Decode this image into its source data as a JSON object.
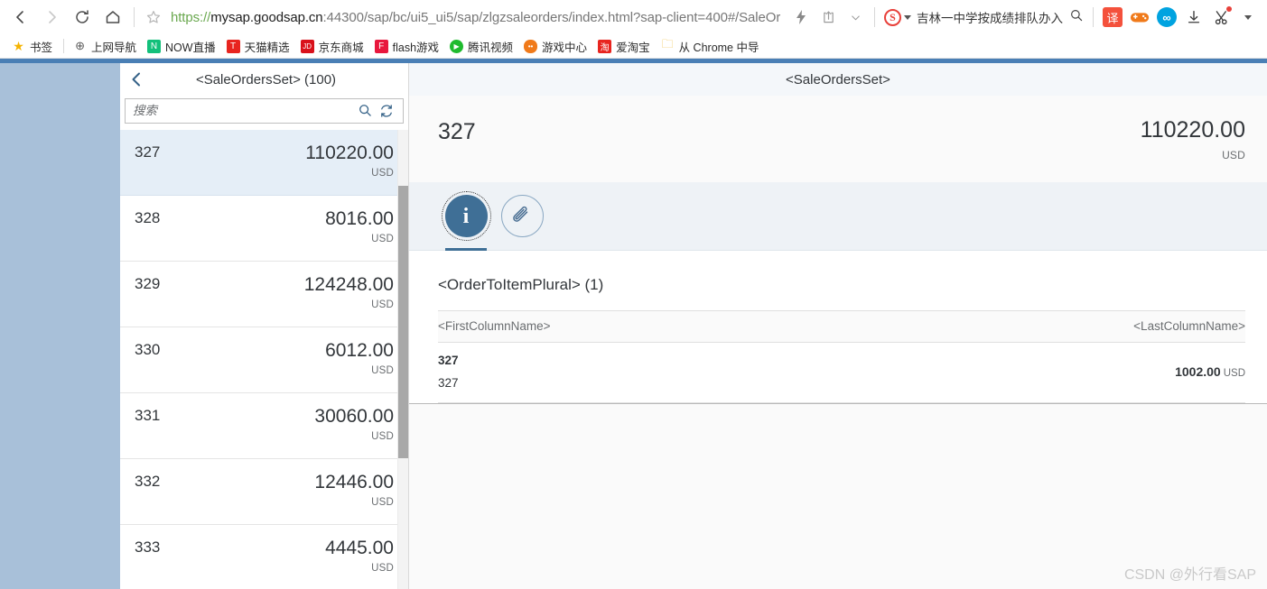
{
  "browser": {
    "nav": {
      "back_label": "Back",
      "forward_label": "Forward",
      "reload_label": "Reload",
      "home_label": "Home",
      "bookmark_star_label": "Bookmark this page"
    },
    "url": {
      "scheme": "https://",
      "host": "mysap.goodsap.cn",
      "rest": ":44300/sap/bc/ui5_ui5/sap/zlgzsaleorders/index.html?sap-client=400#/SaleOr"
    },
    "right_tools": {
      "lightning_label": "Turbo",
      "share_label": "Share",
      "chevron_label": "More",
      "search_engine": "S",
      "search_query": "吉林一中学按成绩排队办入",
      "search_icon_label": "Search",
      "translate_label": "译",
      "game_label": "Game Center",
      "infinity_label": "∞",
      "download_label": "Downloads",
      "capture_label": "Screenshot"
    },
    "bookmarks": [
      {
        "label": "书签",
        "icon": "star-icon",
        "color": "#f5b300",
        "glyph": "★"
      },
      {
        "label": "上网导航",
        "icon": "globe-icon",
        "color": "#ffffff",
        "glyph": "🌐"
      },
      {
        "label": "NOW直播",
        "icon": "now-icon",
        "color": "#13c07b",
        "glyph": "N"
      },
      {
        "label": "天猫精选",
        "icon": "tmall-icon",
        "color": "#e8251f",
        "glyph": "T"
      },
      {
        "label": "京东商城",
        "icon": "jd-icon",
        "color": "#d9111b",
        "glyph": "JD"
      },
      {
        "label": "flash游戏",
        "icon": "flash-icon",
        "color": "#e8173d",
        "glyph": "F"
      },
      {
        "label": "腾讯视频",
        "icon": "tencent-video-icon",
        "color": "#1fbb2e",
        "glyph": "▶"
      },
      {
        "label": "游戏中心",
        "icon": "gamepad-icon",
        "color": "#f07a1a",
        "glyph": "🎮"
      },
      {
        "label": "爱淘宝",
        "icon": "taobao-icon",
        "color": "#e8251f",
        "glyph": "淘"
      },
      {
        "label": "从 Chrome 中导",
        "icon": "folder-icon",
        "color": "#f0c24b",
        "glyph": "📁"
      }
    ]
  },
  "app": {
    "master": {
      "back_label": "‹",
      "title": "<SaleOrdersSet> (100)",
      "search_placeholder": "搜索",
      "search_value": "",
      "search_icon": "magnifier-icon",
      "refresh_icon": "refresh-icon",
      "items": [
        {
          "id": "327",
          "amount": "110220.00",
          "currency": "USD",
          "selected": true
        },
        {
          "id": "328",
          "amount": "8016.00",
          "currency": "USD",
          "selected": false
        },
        {
          "id": "329",
          "amount": "124248.00",
          "currency": "USD",
          "selected": false
        },
        {
          "id": "330",
          "amount": "6012.00",
          "currency": "USD",
          "selected": false
        },
        {
          "id": "331",
          "amount": "30060.00",
          "currency": "USD",
          "selected": false
        },
        {
          "id": "332",
          "amount": "12446.00",
          "currency": "USD",
          "selected": false
        },
        {
          "id": "333",
          "amount": "4445.00",
          "currency": "USD",
          "selected": false
        }
      ]
    },
    "detail": {
      "title": "<SaleOrdersSet>",
      "object_id": "327",
      "object_amount": "110220.00",
      "object_currency": "USD",
      "tabs": [
        {
          "key": "info",
          "icon": "info-icon",
          "glyph": "i",
          "selected": true
        },
        {
          "key": "attachments",
          "icon": "paperclip-icon",
          "glyph": "",
          "selected": false
        }
      ],
      "table": {
        "title": "<OrderToItemPlural> (1)",
        "columns": [
          "<FirstColumnName>",
          "<LastColumnName>"
        ],
        "rows": [
          {
            "primary": "327",
            "secondary": "327",
            "amount": "1002.00",
            "currency": "USD"
          }
        ]
      }
    }
  },
  "watermark": "CSDN @外行看SAP",
  "colors": {
    "shell_bar": "#4a7fb5",
    "app_background": "#a8c0d9",
    "selected_row": "#e5eef7",
    "accent": "#3f6f96"
  }
}
